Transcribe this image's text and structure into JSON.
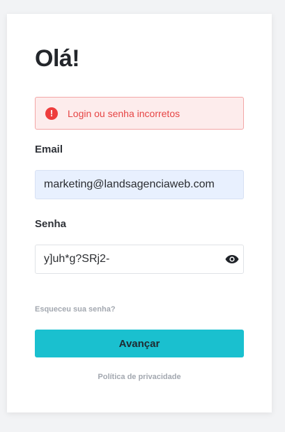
{
  "title": "Olá!",
  "error": {
    "icon": "exclamation-circle-icon",
    "message": "Login ou senha incorretos",
    "color": "#ee3d3d"
  },
  "email": {
    "label": "Email",
    "value": "marketing@landsagenciaweb.com"
  },
  "password": {
    "label": "Senha",
    "value": "y]uh*g?SRj2-",
    "toggle_icon": "eye-icon"
  },
  "links": {
    "forgot": "Esqueceu sua senha?",
    "privacy": "Política de privacidade"
  },
  "submit": {
    "label": "Avançar",
    "color": "#1ac0cf"
  }
}
